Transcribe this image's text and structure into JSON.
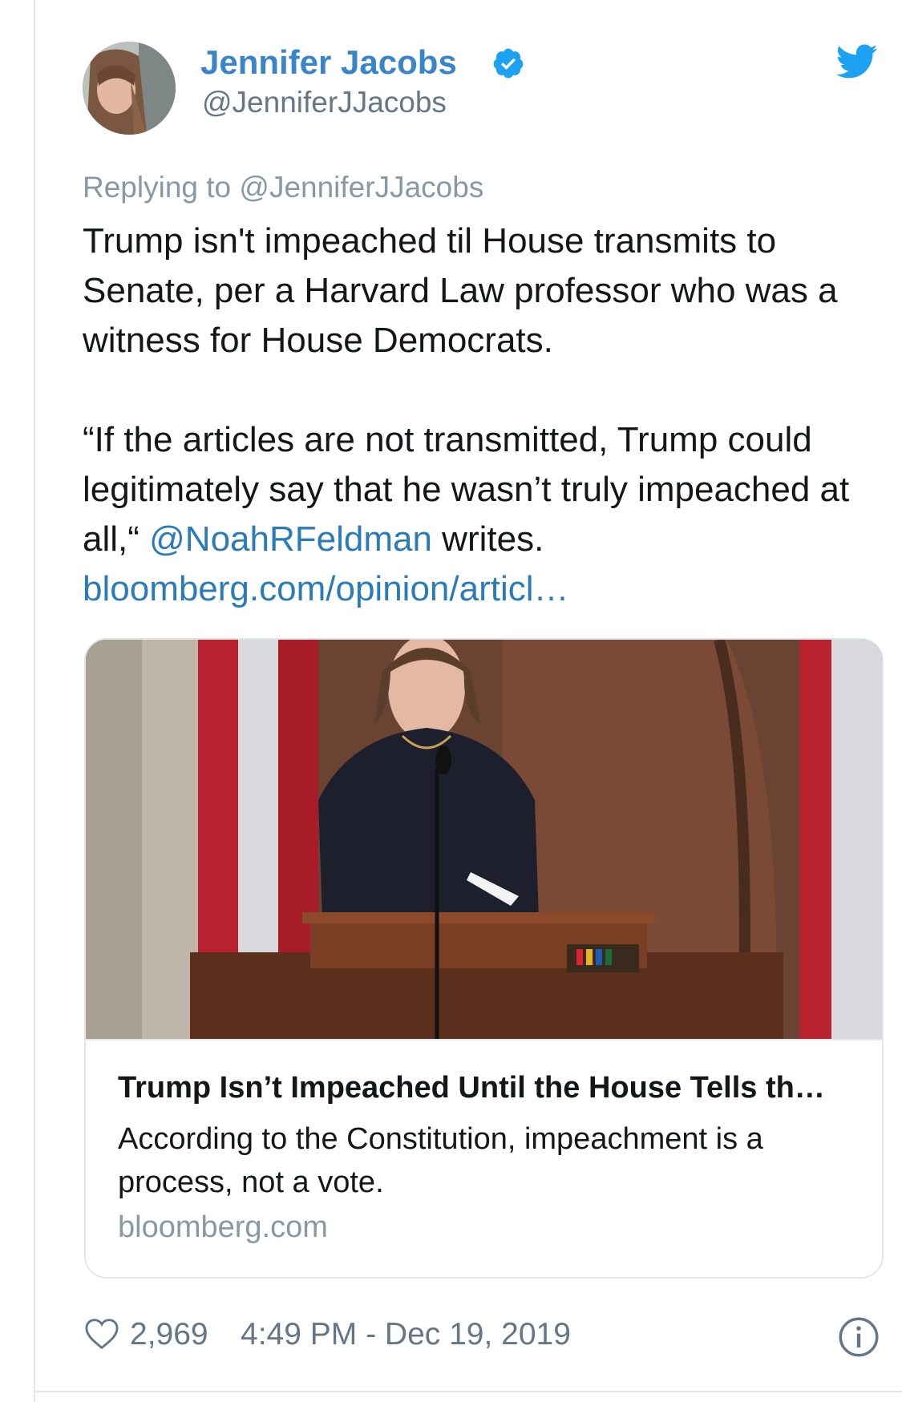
{
  "author": {
    "display_name": "Jennifer Jacobs",
    "handle": "@JenniferJJacobs",
    "verified": true,
    "verified_icon": "verified-badge-icon",
    "platform_icon": "twitter-bird-icon"
  },
  "reply": {
    "prefix": "Replying to",
    "mention": "@JenniferJJacobs"
  },
  "tweet": {
    "paragraph1": "Trump isn't impeached til House transmits to Senate, per a Harvard Law professor who was a witness for House Democrats.",
    "paragraph2_start": "“If the articles are not transmitted, Trump could legitimately say that he wasn’t truly impeached at all,“ ",
    "mention": "@NoahRFeldman",
    "paragraph2_end": " writes.",
    "link": "bloomberg.com/opinion/articl…"
  },
  "card": {
    "title": "Trump Isn’t Impeached Until the House Tells th…",
    "description": "According to the Constitution, impeachment is a process, not a vote.",
    "domain": "bloomberg.com"
  },
  "footer": {
    "likes": "2,969",
    "timestamp": "4:49 PM - Dec 19, 2019",
    "like_icon": "heart-icon",
    "info_icon": "info-icon"
  },
  "colors": {
    "name": "#3a84c9",
    "link": "#2b7bb9",
    "muted": "#8899a6",
    "verified": "#1da1f2",
    "twitter_bird": "#1da1f2"
  }
}
